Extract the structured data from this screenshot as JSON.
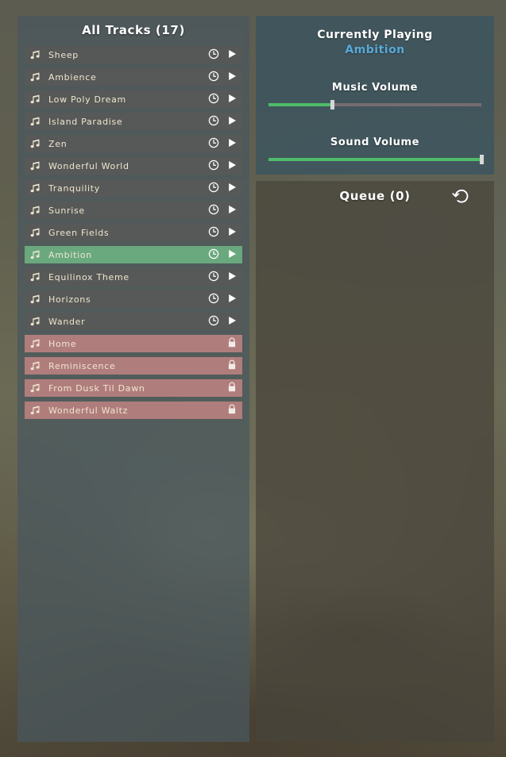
{
  "tracks_panel": {
    "title": "All Tracks (17)",
    "icons": {
      "note": "music-note-icon",
      "clock": "clock-icon",
      "play": "play-icon",
      "lock": "lock-icon"
    },
    "rows": [
      {
        "title": "Sheep",
        "state": "normal",
        "actions": [
          "clock",
          "play"
        ]
      },
      {
        "title": "Ambience",
        "state": "normal",
        "actions": [
          "clock",
          "play"
        ]
      },
      {
        "title": "Low Poly Dream",
        "state": "normal",
        "actions": [
          "clock",
          "play"
        ]
      },
      {
        "title": "Island Paradise",
        "state": "normal",
        "actions": [
          "clock",
          "play"
        ]
      },
      {
        "title": "Zen",
        "state": "normal",
        "actions": [
          "clock",
          "play"
        ]
      },
      {
        "title": "Wonderful World",
        "state": "normal",
        "actions": [
          "clock",
          "play"
        ]
      },
      {
        "title": "Tranquility",
        "state": "normal",
        "actions": [
          "clock",
          "play"
        ]
      },
      {
        "title": "Sunrise",
        "state": "normal",
        "actions": [
          "clock",
          "play"
        ]
      },
      {
        "title": "Green Fields",
        "state": "normal",
        "actions": [
          "clock",
          "play"
        ]
      },
      {
        "title": "Ambition",
        "state": "selected",
        "actions": [
          "clock",
          "play"
        ]
      },
      {
        "title": "Equilinox Theme",
        "state": "normal",
        "actions": [
          "clock",
          "play"
        ]
      },
      {
        "title": "Horizons",
        "state": "normal",
        "actions": [
          "clock",
          "play"
        ]
      },
      {
        "title": "Wander",
        "state": "normal",
        "actions": [
          "clock",
          "play"
        ]
      },
      {
        "title": "Home",
        "state": "locked",
        "actions": [
          "lock"
        ]
      },
      {
        "title": "Reminiscence",
        "state": "locked",
        "actions": [
          "lock"
        ]
      },
      {
        "title": "From Dusk Til Dawn",
        "state": "locked",
        "actions": [
          "lock"
        ]
      },
      {
        "title": "Wonderful Waltz",
        "state": "locked",
        "actions": [
          "lock"
        ]
      }
    ]
  },
  "now_playing": {
    "heading": "Currently Playing",
    "track": "Ambition",
    "track_color": "#59a9d8",
    "sliders": [
      {
        "label": "Music Volume",
        "value": 30,
        "fill_color": "#4fbb6a"
      },
      {
        "label": "Sound Volume",
        "value": 100,
        "fill_color": "#4fbb6a"
      }
    ]
  },
  "queue": {
    "title": "Queue (0)",
    "reset_icon": "reset-loop-icon",
    "items": []
  },
  "theme": {
    "row_normal": "#595959",
    "row_selected": "#6aa87d",
    "row_locked": "#b07d7d",
    "text_cream": "#efe6cf"
  }
}
